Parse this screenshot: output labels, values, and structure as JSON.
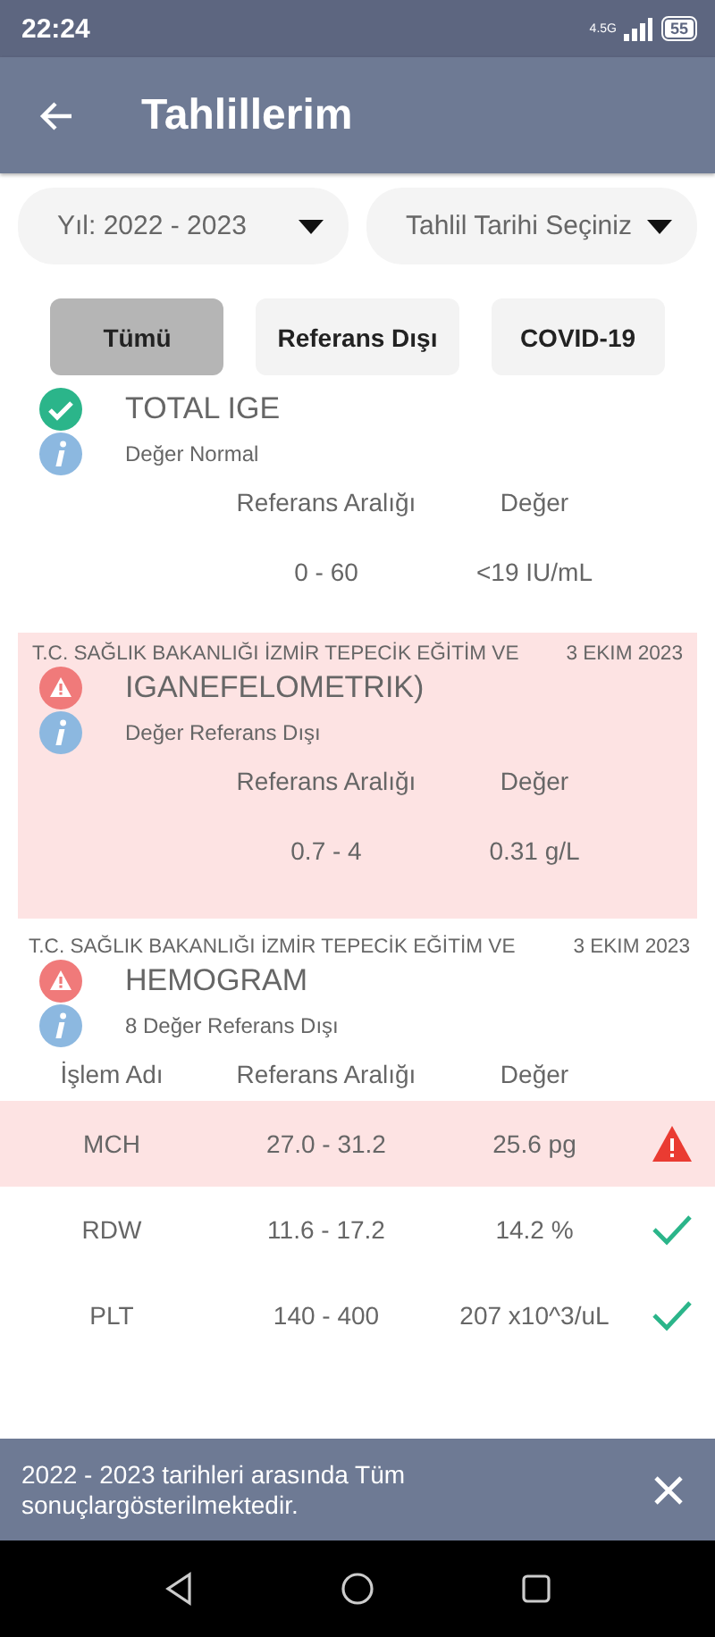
{
  "status_bar": {
    "time": "22:24",
    "network": "4.5G",
    "battery": "55"
  },
  "app_bar": {
    "title": "Tahlillerim"
  },
  "filters": [
    {
      "label": "Yıl: 2022 - 2023"
    },
    {
      "label": "Tahlil Tarihi Seçiniz"
    }
  ],
  "tabs": [
    {
      "label": "Tümü",
      "selected": true
    },
    {
      "label": "Referans Dışı",
      "selected": false
    },
    {
      "label": "COVID-19",
      "selected": false
    }
  ],
  "results": [
    {
      "out_of_range": false,
      "title": "TOTAL IGE",
      "summary": "Değer Normal",
      "highlighted": false,
      "columns": [
        "Referans Aralığı",
        "Değer"
      ],
      "rows": [
        {
          "range": "0 - 60",
          "value": "<19 IU/mL"
        }
      ]
    },
    {
      "institution": "T.C. SAĞLIK BAKANLIĞI İZMİR TEPECİK EĞİTİM VE",
      "date": "3 EKIM 2023",
      "out_of_range": true,
      "title": "IGANEFELOMETRIK)",
      "summary": "Değer Referans Dışı",
      "highlighted": true,
      "columns": [
        "Referans Aralığı",
        "Değer"
      ],
      "rows": [
        {
          "range": "0.7 - 4",
          "value": "0.31 g/L"
        }
      ]
    },
    {
      "institution": "T.C. SAĞLIK BAKANLIĞI İZMİR TEPECİK EĞİTİM VE",
      "date": "3 EKIM 2023",
      "out_of_range": true,
      "title": "HEMOGRAM",
      "summary": "8 Değer Referans Dışı",
      "highlighted": false,
      "columns": [
        "İşlem Adı",
        "Referans Aralığı",
        "Değer"
      ],
      "rows": [
        {
          "name": "MCH",
          "range": "27.0 - 31.2",
          "value": "25.6 pg",
          "out_of_range": true,
          "highlighted": true
        },
        {
          "name": "RDW",
          "range": "11.6 - 17.2",
          "value": "14.2 %",
          "out_of_range": false,
          "highlighted": false
        },
        {
          "name": "PLT",
          "range": "140 - 400",
          "value": "207 x10^3/uL",
          "out_of_range": false,
          "highlighted": false
        }
      ]
    }
  ],
  "snackbar": {
    "message": "2022 - 2023 tarihleri arasında Tüm sonuçlargösterilmektedir."
  }
}
